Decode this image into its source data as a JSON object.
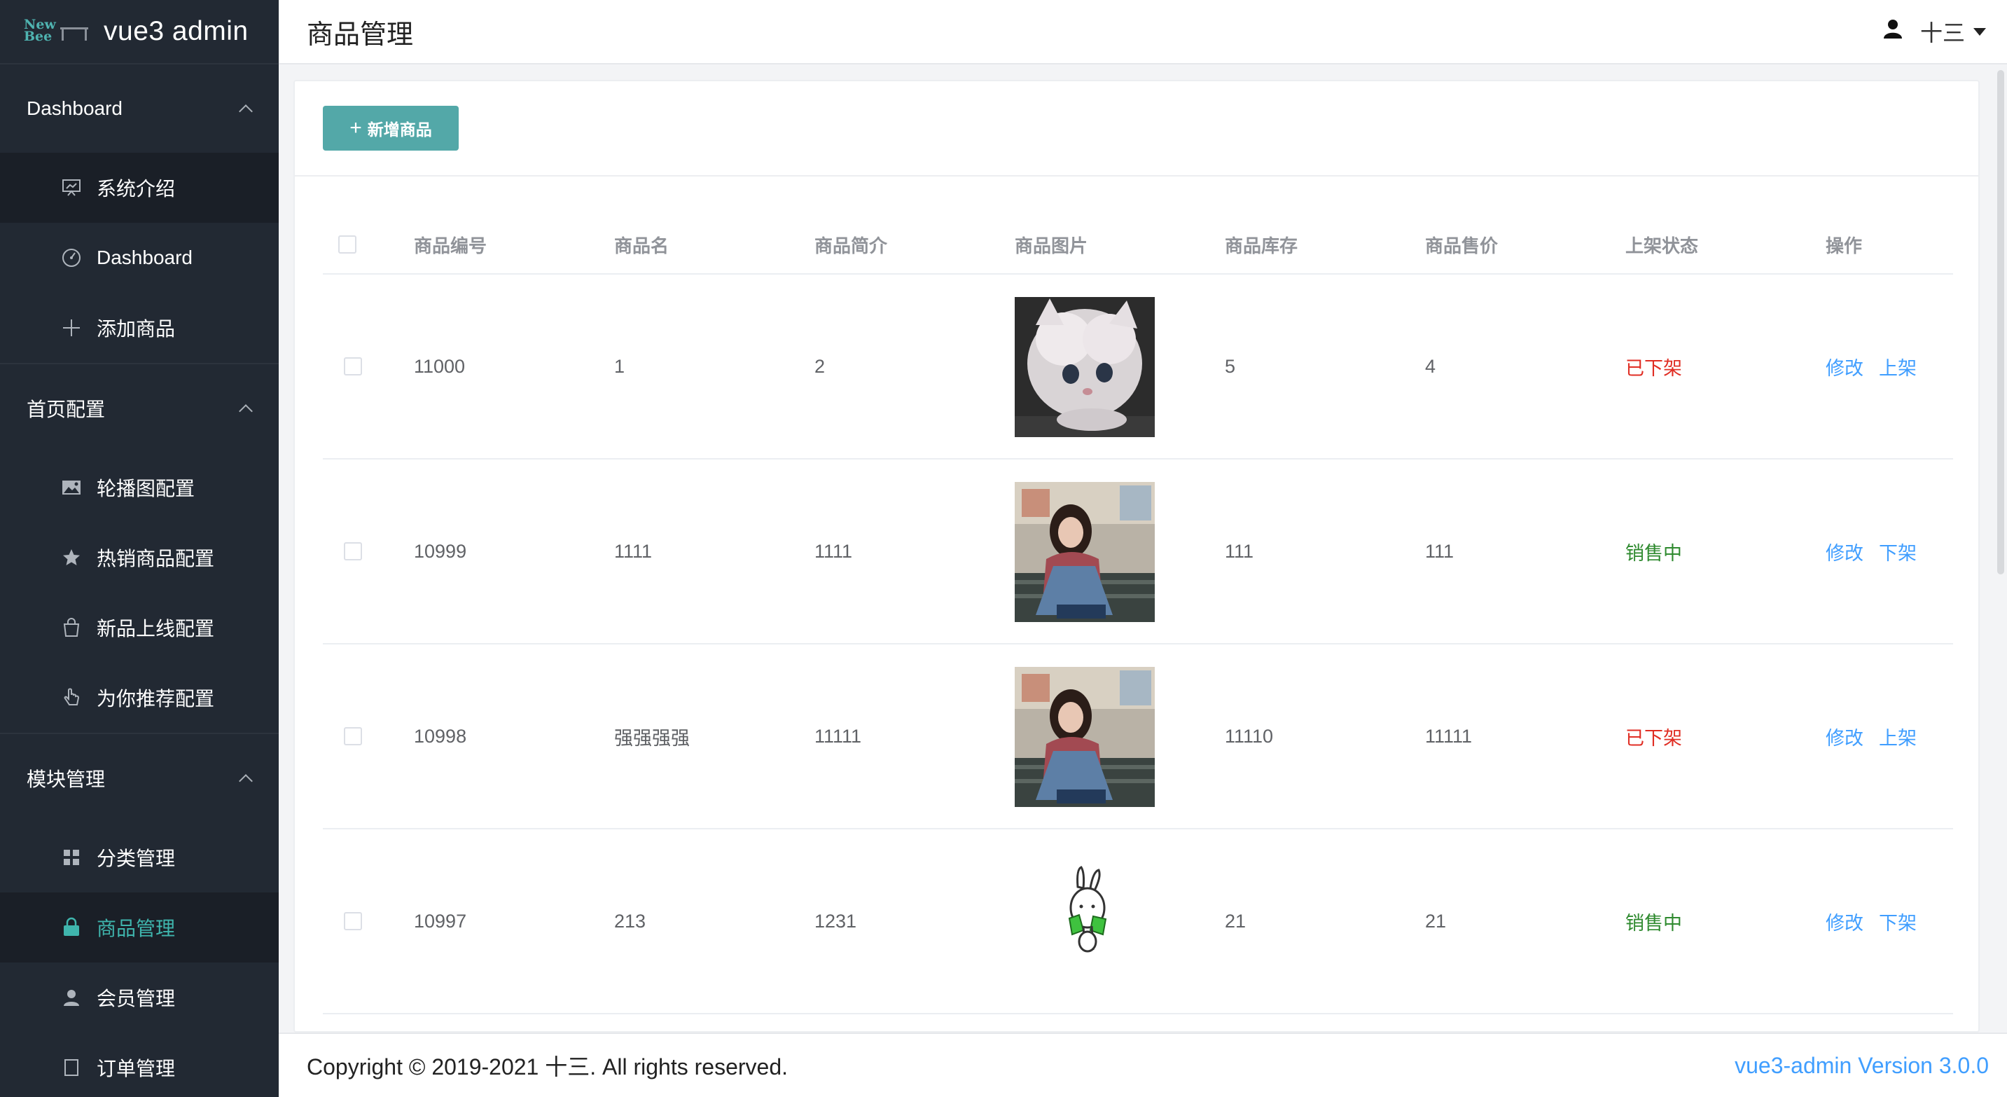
{
  "app": {
    "logo_mark": "New\nBee",
    "logo_text": "vue3 admin"
  },
  "sidebar": {
    "groups": [
      {
        "title": "Dashboard",
        "items": [
          {
            "label": "系统介绍",
            "icon": "presentation-icon"
          },
          {
            "label": "Dashboard",
            "icon": "gauge-icon"
          },
          {
            "label": "添加商品",
            "icon": "plus-icon"
          }
        ]
      },
      {
        "title": "首页配置",
        "items": [
          {
            "label": "轮播图配置",
            "icon": "picture-icon"
          },
          {
            "label": "热销商品配置",
            "icon": "star-icon"
          },
          {
            "label": "新品上线配置",
            "icon": "shopping-bag-icon"
          },
          {
            "label": "为你推荐配置",
            "icon": "hand-pointer-icon"
          }
        ]
      },
      {
        "title": "模块管理",
        "items": [
          {
            "label": "分类管理",
            "icon": "grid-icon"
          },
          {
            "label": "商品管理",
            "icon": "lock-bag-icon"
          },
          {
            "label": "会员管理",
            "icon": "user-icon"
          },
          {
            "label": "订单管理",
            "icon": "order-icon"
          }
        ]
      }
    ]
  },
  "header": {
    "title": "商品管理",
    "username": "十三"
  },
  "toolbar": {
    "add_label": "新增商品",
    "add_icon": "+"
  },
  "table": {
    "columns": [
      "商品编号",
      "商品名",
      "商品简介",
      "商品图片",
      "商品库存",
      "商品售价",
      "上架状态",
      "操作"
    ],
    "rows": [
      {
        "id": "11000",
        "name": "1",
        "intro": "2",
        "image": "kitten",
        "stock": "5",
        "price": "4",
        "status": "已下架",
        "status_type": "off",
        "op_edit": "修改",
        "op_toggle": "上架"
      },
      {
        "id": "10999",
        "name": "1111",
        "intro": "1111",
        "image": "girl",
        "stock": "111",
        "price": "111",
        "status": "销售中",
        "status_type": "on",
        "op_edit": "修改",
        "op_toggle": "下架"
      },
      {
        "id": "10998",
        "name": "强强强强",
        "intro": "11111",
        "image": "girl",
        "stock": "11110",
        "price": "11111",
        "status": "已下架",
        "status_type": "off",
        "op_edit": "修改",
        "op_toggle": "上架"
      },
      {
        "id": "10997",
        "name": "213",
        "intro": "1231",
        "image": "bunny",
        "stock": "21",
        "price": "21",
        "status": "销售中",
        "status_type": "on",
        "op_edit": "修改",
        "op_toggle": "下架"
      }
    ]
  },
  "footer": {
    "copyright": "Copyright © 2019-2021 十三. All rights reserved.",
    "version": "vue3-admin Version 3.0.0"
  },
  "colors": {
    "sidebar_bg": "#222933",
    "accent": "#53a8a8",
    "link": "#409eff",
    "status_off": "#e02e24",
    "status_on": "#2f8a2f"
  }
}
